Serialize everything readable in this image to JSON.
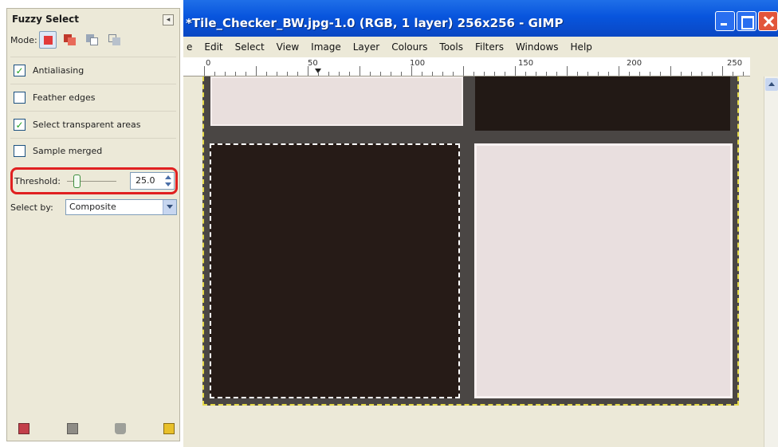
{
  "tool_options": {
    "title": "Fuzzy Select",
    "mode_label": "Mode:",
    "antialiasing": {
      "label": "Antialiasing",
      "checked": true
    },
    "feather_edges": {
      "label": "Feather edges",
      "checked": false
    },
    "select_transparent": {
      "label": "Select transparent areas",
      "checked": true
    },
    "sample_merged": {
      "label": "Sample merged",
      "checked": false
    },
    "threshold": {
      "label": "Threshold:",
      "value": "25.0"
    },
    "select_by": {
      "label": "Select by:",
      "value": "Composite"
    },
    "check_mark": "✓"
  },
  "window": {
    "title": "*Tile_Checker_BW.jpg-1.0 (RGB, 1 layer) 256x256 - GIMP",
    "menu": [
      "e",
      "Edit",
      "Select",
      "View",
      "Image",
      "Layer",
      "Colours",
      "Tools",
      "Filters",
      "Windows",
      "Help"
    ],
    "ruler_labels": [
      "0",
      "50",
      "100",
      "150",
      "200",
      "250"
    ]
  },
  "colors": {
    "titlebar": "#0855dd",
    "highlight": "#e02020",
    "dark_tile": "#261b17",
    "light_tile": "#e9dfdf"
  }
}
